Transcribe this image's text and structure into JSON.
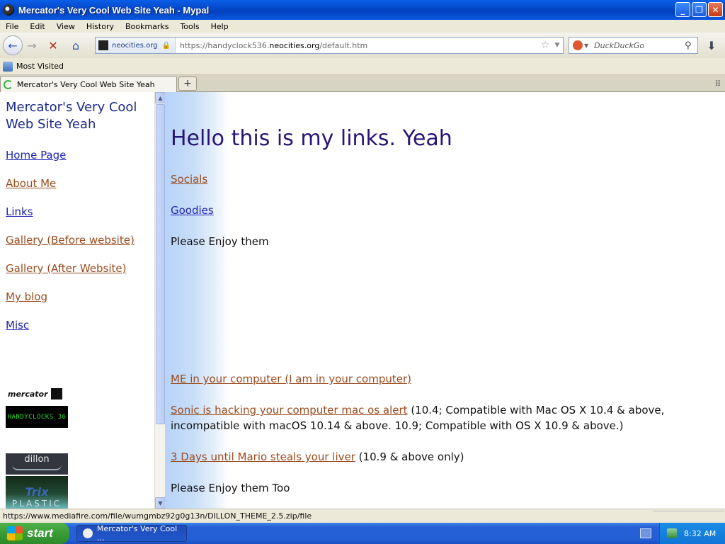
{
  "window": {
    "title": "Mercator's Very Cool Web Site Yeah - Mypal",
    "buttons": {
      "minimize": "_",
      "maximize": "❐",
      "close": "✕"
    }
  },
  "menu": [
    "File",
    "Edit",
    "View",
    "History",
    "Bookmarks",
    "Tools",
    "Help"
  ],
  "nav": {
    "back_icon": "back-arrow-icon",
    "forward_icon": "forward-arrow-icon",
    "stop_icon": "stop-icon",
    "home_icon": "home-icon",
    "site_domain": "neocities.org",
    "url_prefix": "https://handyclock536.",
    "url_host": "neocities.org",
    "url_path": "/default.htm",
    "search_placeholder": "DuckDuckGo"
  },
  "bookmarks": {
    "most_visited": "Most Visited"
  },
  "tabs": [
    {
      "title": "Mercator's Very Cool Web Site Yeah",
      "loading": true
    }
  ],
  "sidebar": {
    "title": "Mercator's Very Cool Web Site Yeah",
    "links": [
      {
        "label": "Home Page",
        "color": "#1f24b0"
      },
      {
        "label": "About Me",
        "color": "#9a4c1e"
      },
      {
        "label": "Links",
        "color": "#1f24b0"
      },
      {
        "label": "Gallery (Before website)",
        "color": "#9a4c1e"
      },
      {
        "label": "Gallery (After Website)",
        "color": "#9a4c1e"
      },
      {
        "label": "My blog",
        "color": "#9a4c1e"
      },
      {
        "label": "Misc",
        "color": "#1f24b0"
      }
    ],
    "badges": {
      "mercator": "mercator",
      "handyclocks": "HANDYCLOCKS 36",
      "dillon": "dillon",
      "trix": "Trix",
      "plastic": "PLASTIC"
    }
  },
  "main": {
    "heading": "Hello this is my links. Yeah",
    "link_socials": "Socials",
    "link_goodies": "Goodies",
    "enjoy_1": "Please Enjoy them",
    "link_me_in_computer": "ME in your computer (I am in your computer)",
    "link_sonic": "Sonic is hacking your computer mac os alert",
    "sonic_note": " (10.4; Compatible with Mac OS X 10.4 & above, incompatible with macOS 10.14 & above. 10.9; Compatible with OS X 10.9 & above.)",
    "link_mario": "3 Days until Mario steals your liver",
    "mario_note": " (10.9 & above only)",
    "enjoy_2": "Please Enjoy them Too"
  },
  "status": {
    "url": "https://www.mediafire.com/file/wumgmbz92g0g13n/DILLON_THEME_2.5.zip/file"
  },
  "taskbar": {
    "start": "start",
    "task_label": "Mercator's Very Cool ...",
    "clock": "8:32 AM"
  }
}
